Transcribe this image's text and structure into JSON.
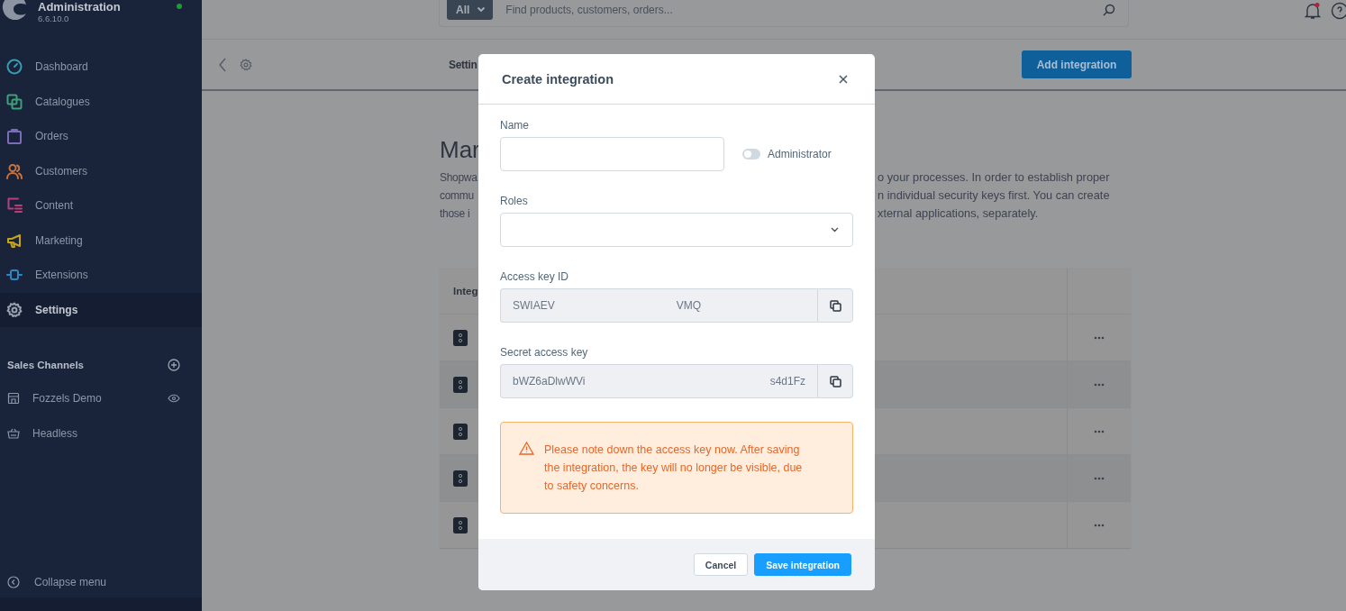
{
  "sidebar": {
    "title": "Administration",
    "version": "6.6.10.0",
    "online": true,
    "items": [
      {
        "label": "Dashboard",
        "color": "#3a9cb0",
        "selected": false
      },
      {
        "label": "Catalogues",
        "color": "#3da17a",
        "selected": false
      },
      {
        "label": "Orders",
        "color": "#7b6bb8",
        "selected": false
      },
      {
        "label": "Customers",
        "color": "#c8733e",
        "selected": false
      },
      {
        "label": "Content",
        "color": "#b8407a",
        "selected": false
      },
      {
        "label": "Marketing",
        "color": "#c5a418",
        "selected": false
      },
      {
        "label": "Extensions",
        "color": "#2f86c4",
        "selected": false
      },
      {
        "label": "Settings",
        "color": "#9aa3b2",
        "selected": true
      }
    ],
    "sales_channels": {
      "title": "Sales Channels",
      "items": [
        {
          "label": "Fozzels Demo",
          "visible": true
        },
        {
          "label": "Headless",
          "visible": false
        }
      ]
    },
    "collapse": "Collapse menu"
  },
  "topbar": {
    "scope": "All",
    "placeholder": "Find products, customers, orders...",
    "unread": true
  },
  "page": {
    "title": "Settin",
    "add_button": "Add integration",
    "heading": "Mar",
    "description_left": [
      "Shopwa",
      "commu",
      "those i"
    ],
    "description_right": [
      "o your processes. In order to establish proper",
      "n individual security keys first. You can create",
      "xternal applications, separately."
    ],
    "table": {
      "header": "Integ",
      "rows": [
        {
          "kind": "integration"
        },
        {
          "kind": "integration"
        },
        {
          "kind": "integration"
        },
        {
          "kind": "integration"
        },
        {
          "kind": "integration"
        }
      ]
    }
  },
  "modal": {
    "title": "Create integration",
    "name_label": "Name",
    "admin_label": "Administrator",
    "admin_on": false,
    "roles_label": "Roles",
    "access_key_label": "Access key ID",
    "access_key": [
      "SWIAEV",
      "VMQ"
    ],
    "secret_label": "Secret access key",
    "secret_key": [
      "bWZ6aDlwWVi",
      "s4d1Fz"
    ],
    "warning": "Please note down the access key now. After saving the integration, the key will no longer be visible, due to safety concerns.",
    "buttons": [
      "Cancel",
      "Save integration"
    ]
  }
}
